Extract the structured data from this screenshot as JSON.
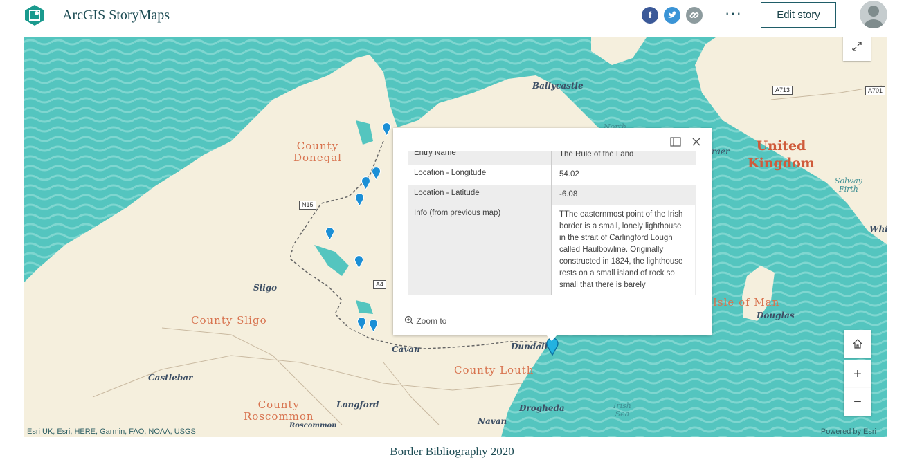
{
  "header": {
    "app_title": "ArcGIS StoryMaps",
    "share_icons": [
      "facebook-icon",
      "twitter-icon",
      "link-icon"
    ],
    "more_label": "···",
    "edit_button": "Edit story"
  },
  "map": {
    "labels": {
      "donegal": "County\nDonegal",
      "sligo_county": "County Sligo",
      "roscommon_county": "County\nRoscommon",
      "louth": "County Louth",
      "uk": "United\nKingdom",
      "isle_of_man": "Isle of Man",
      "ballycastle": "Ballycastle",
      "sligo": "Sligo",
      "castlebar": "Castlebar",
      "longford": "Longford",
      "cavan": "Cavan",
      "dundalk": "Dundalk",
      "drogheda": "Drogheda",
      "navan": "Navan",
      "roscommon": "Roscommon",
      "douglas": "Douglas",
      "solway": "Solway\nFirth",
      "irish_sea": "Irish\nSea",
      "north_channel": "North",
      "whit": "Whit",
      "raer": "raer"
    },
    "roads": [
      "A713",
      "A701",
      "N15",
      "A4"
    ],
    "attribution_left": "Esri UK, Esri, HERE, Garmin, FAO, NOAA, USGS",
    "attribution_right": "Powered by Esri",
    "controls": [
      "expand-icon",
      "home-icon",
      "zoom-in-icon",
      "zoom-out-icon"
    ]
  },
  "popup": {
    "rows": [
      {
        "key": "Entry Name",
        "value": "The Rule of the Land"
      },
      {
        "key": "Location - Longitude",
        "value": "54.02"
      },
      {
        "key": "Location - Latitude",
        "value": "-6.08"
      },
      {
        "key": "Info (from previous map)",
        "value": "TThe easternmost point of the Irish border is a small, lonely lighthouse in the strait of Carlingford Lough called Haulbowline. Originally constructed in 1824, the lighthouse rests on a small island of rock so small that there is barely"
      }
    ],
    "zoom_to": "Zoom to"
  },
  "footer": {
    "title": "Border Bibliography 2020"
  },
  "colors": {
    "sea": "#54c5bf",
    "land": "#f5efdd",
    "county_label": "#d8734f",
    "pin": "#1b8fd6",
    "brand": "#1d4c54"
  }
}
